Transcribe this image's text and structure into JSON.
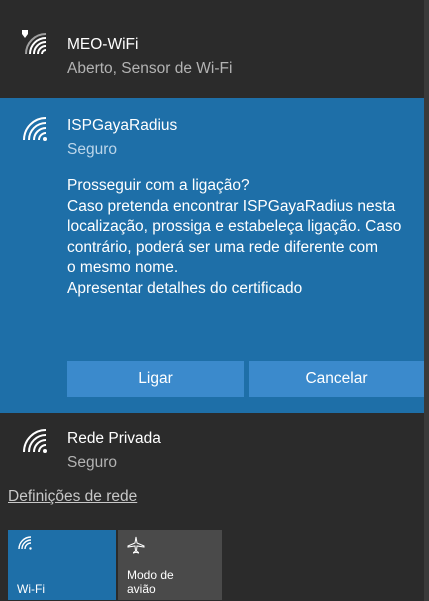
{
  "networks": [
    {
      "name": "MEO-WiFi",
      "status": "Aberto, Sensor de Wi-Fi",
      "icon": "wifi-open-shield-icon"
    },
    {
      "name": "ISPGayaRadius",
      "status": "Seguro",
      "icon": "wifi-icon",
      "prompt": {
        "question": "Prosseguir com a ligação?",
        "lines": [
          "Caso pretenda encontrar ISPGayaRadius nesta",
          "localização, prossiga e estabeleça ligação. Caso",
          "contrário, poderá ser uma rede diferente com",
          "o mesmo nome."
        ],
        "cert_link": "Apresentar detalhes do certificado"
      },
      "connect_label": "Ligar",
      "cancel_label": "Cancelar"
    },
    {
      "name": "Rede Privada",
      "status": "Seguro",
      "icon": "wifi-icon"
    }
  ],
  "settings_link": "Definições de rede",
  "quick_actions": [
    {
      "label": "Wi-Fi",
      "icon": "wifi-icon",
      "active": true
    },
    {
      "label_line1": "Modo de",
      "label_line2": "avião",
      "icon": "airplane-icon",
      "active": false
    }
  ],
  "colors": {
    "background": "#2b2b2b",
    "accent": "#1e6fa8",
    "button": "#3b8acc"
  }
}
